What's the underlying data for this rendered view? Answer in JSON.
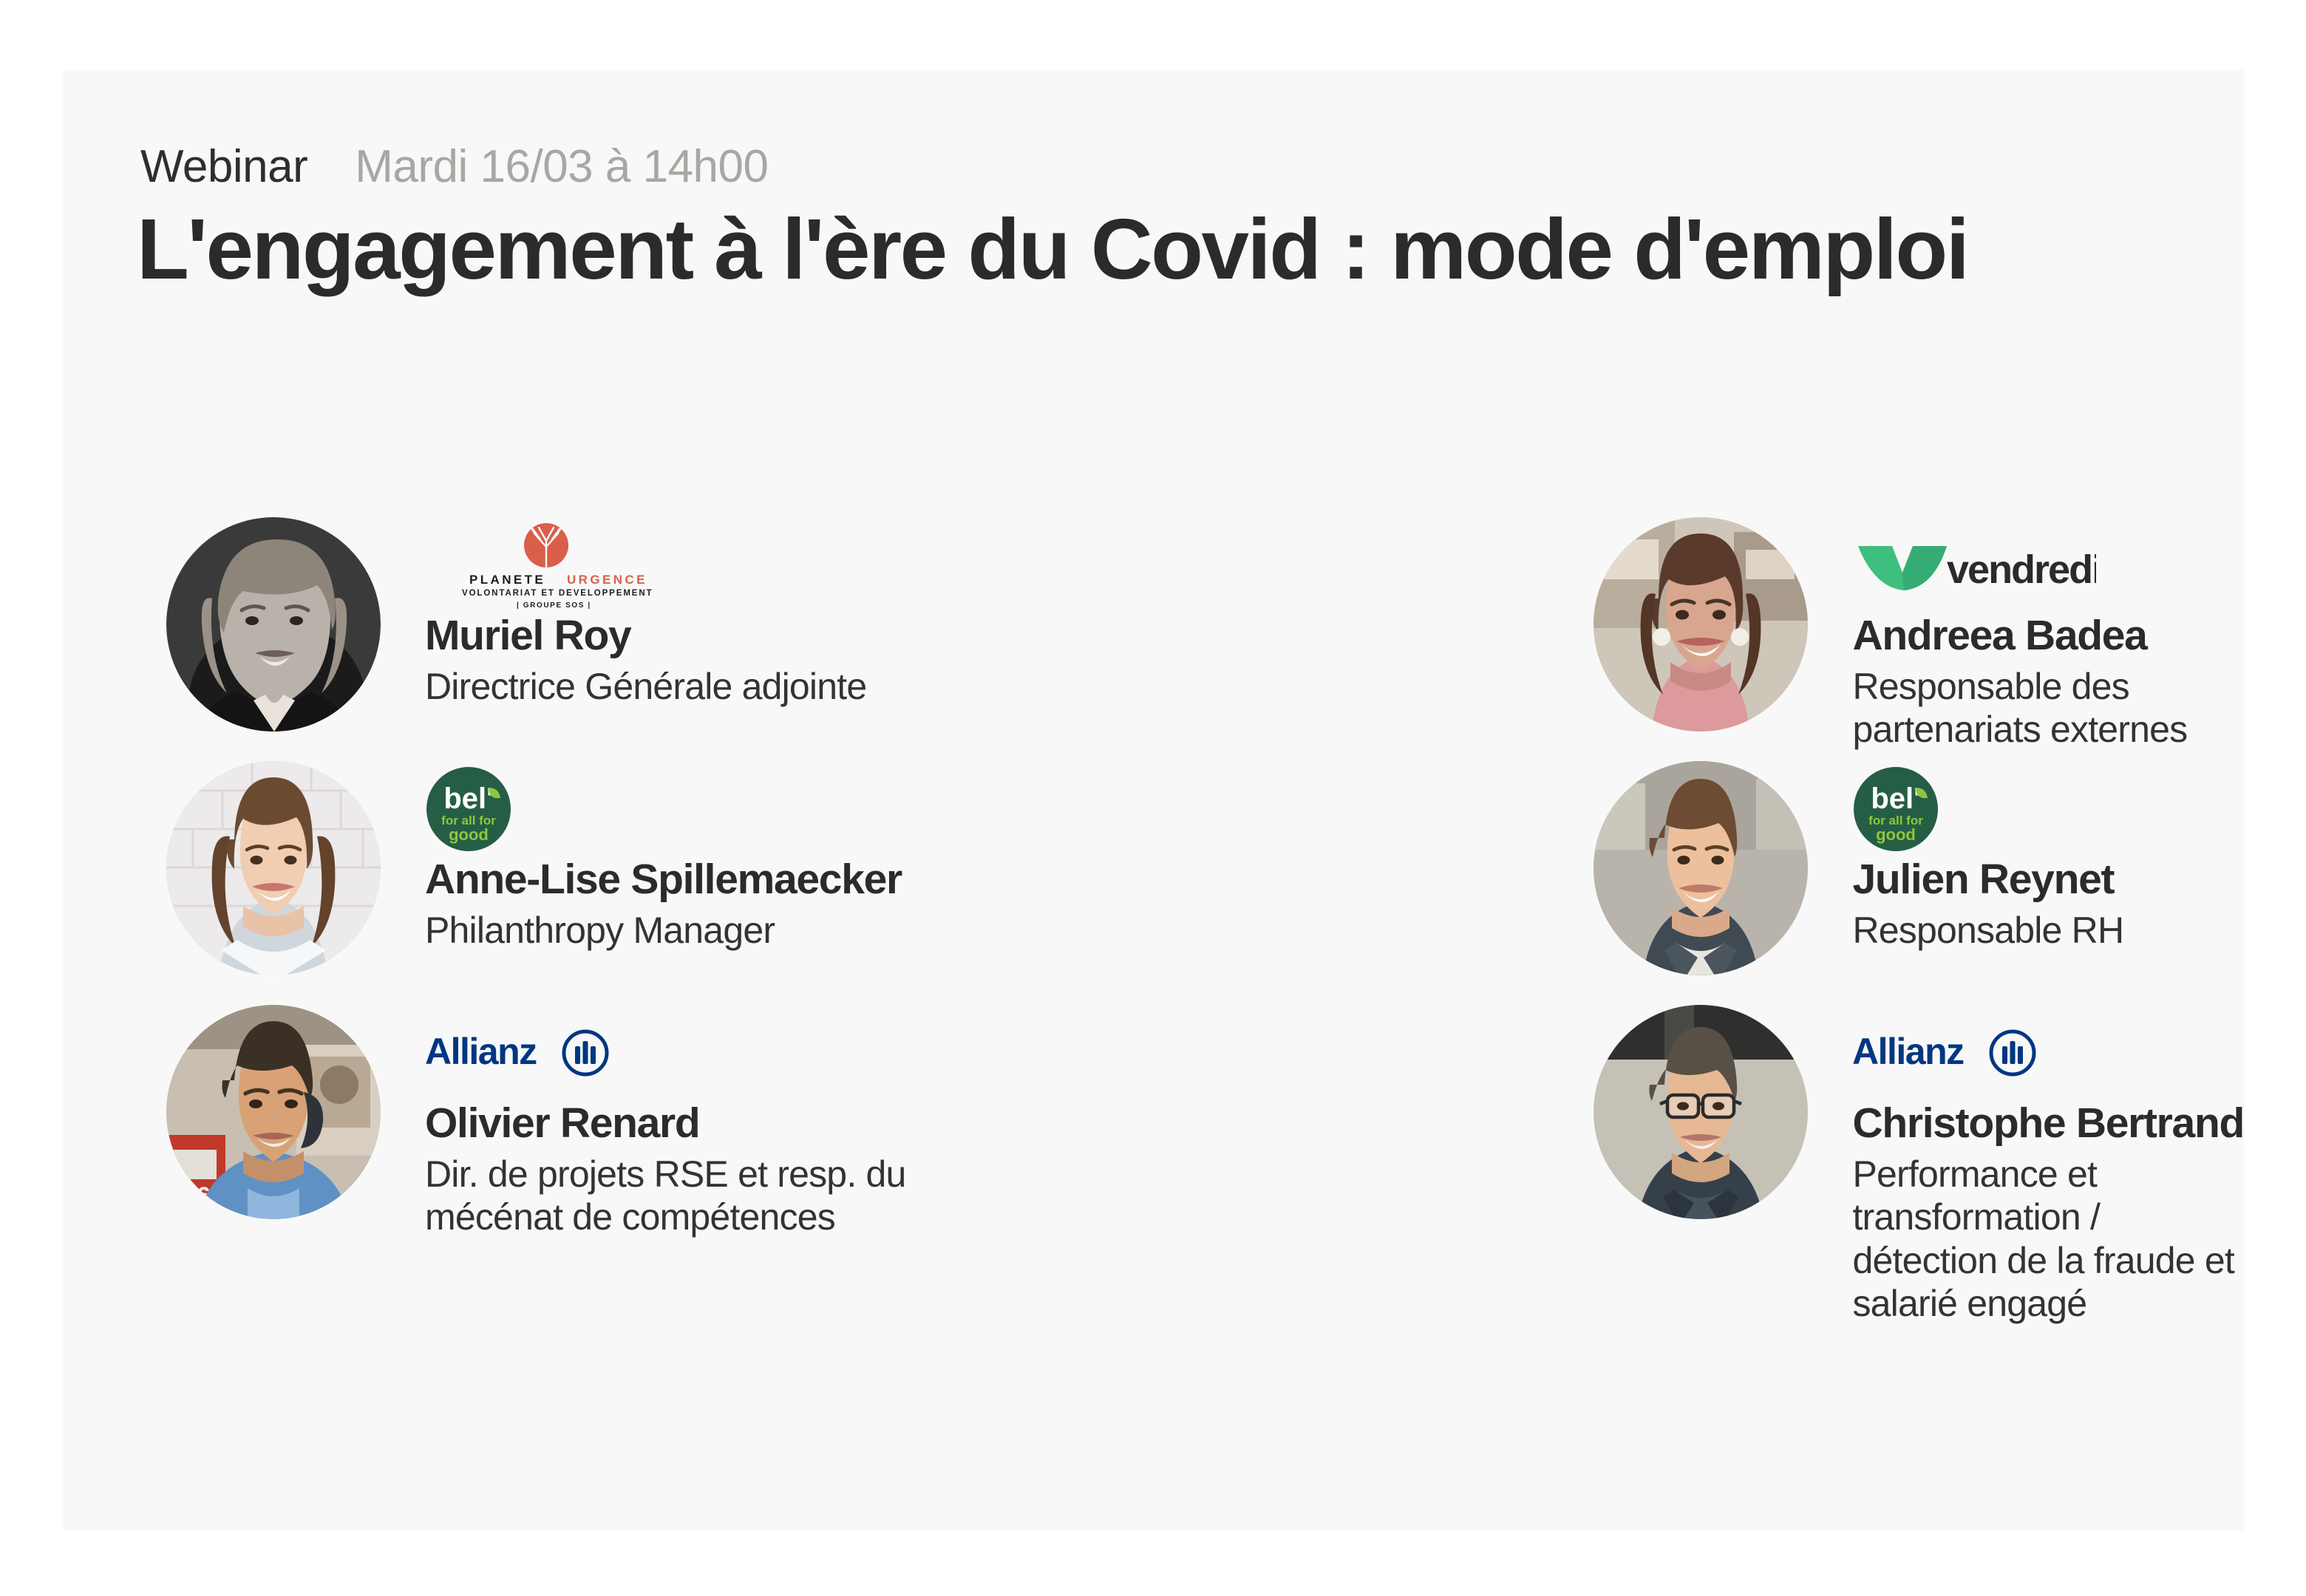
{
  "poster": {
    "background_color": "#f8f8f8",
    "page_background": "#ffffff",
    "kicker": "Webinar",
    "date": "Mardi 16/03 à 14h00",
    "title": "L'engagement à l'ère du Covid : mode d'emploi"
  },
  "colors": {
    "title_text": "#2b2b2b",
    "date_text": "#a9a6a3",
    "planete_urgence_red": "#d95f4a",
    "vendredi_green": "#3ebe7f",
    "bel_dark_green": "#255e45",
    "bel_light_green": "#8ec63f",
    "allianz_blue": "#003781"
  },
  "speakers": [
    {
      "name": "Muriel Roy",
      "role": "Directrice Générale adjointe",
      "logo": "planete-urgence-logo",
      "logo_text": {
        "line1_dark": "PLANETE",
        "line1_accent": "URGENCE",
        "line2": "VOLONTARIAT ET DEVELOPPEMENT",
        "line3": "| GROUPE SOS |"
      },
      "avatar": "portrait-muriel-roy",
      "column": "left",
      "row": 1
    },
    {
      "name": "Andreea Badea",
      "role": "Responsable des partenariats externes",
      "logo": "vendredi-logo",
      "logo_text": {
        "wordmark": "vendredi"
      },
      "avatar": "portrait-andreea-badea",
      "column": "right",
      "row": 1
    },
    {
      "name": "Anne-Lise Spillemaecker",
      "role": "Philanthropy Manager",
      "logo": "bel-for-all-for-good-logo",
      "logo_text": {
        "wordmark": "bel'",
        "tagline1": "for all for",
        "tagline2": "good"
      },
      "avatar": "portrait-anne-lise-spillemaecker",
      "column": "left",
      "row": 2
    },
    {
      "name": "Julien Reynet",
      "role": "Responsable RH",
      "logo": "bel-for-all-for-good-logo",
      "logo_text": {
        "wordmark": "bel'",
        "tagline1": "for all for",
        "tagline2": "good"
      },
      "avatar": "portrait-julien-reynet",
      "column": "right",
      "row": 2
    },
    {
      "name": "Olivier Renard",
      "role": "Dir. de projets RSE et resp. du mécénat de compétences",
      "logo": "allianz-logo",
      "logo_text": {
        "wordmark": "Allianz"
      },
      "avatar": "portrait-olivier-renard",
      "column": "left",
      "row": 3
    },
    {
      "name": "Christophe Bertrand",
      "role": "Performance et transformation / détection de la fraude et salarié engagé",
      "logo": "allianz-logo",
      "logo_text": {
        "wordmark": "Allianz"
      },
      "avatar": "portrait-christophe-bertrand",
      "column": "right",
      "row": 3
    }
  ]
}
